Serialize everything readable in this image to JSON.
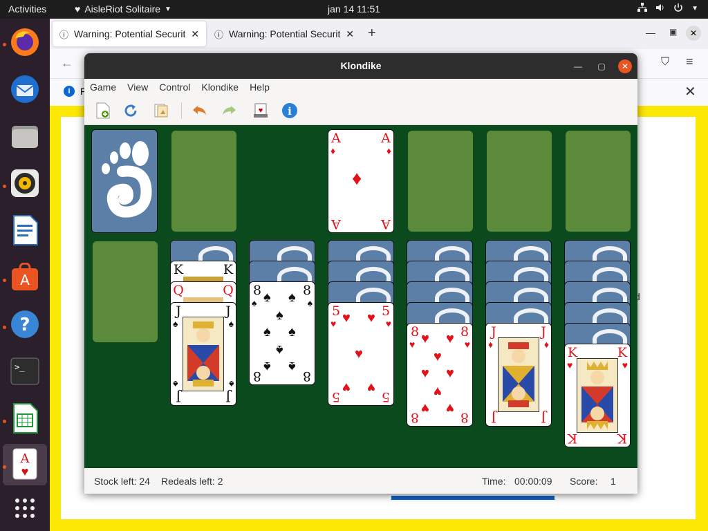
{
  "topbar": {
    "activities": "Activities",
    "app_name": "AisleRiot Solitaire",
    "clock": "jan 14  11:51"
  },
  "browser": {
    "tabs": [
      {
        "label": "Warning: Potential Security Risk Ahead"
      },
      {
        "label": "Warning: Potential Security Risk Ahead"
      }
    ],
    "infobar_fragment": "F",
    "content_fragment": "d"
  },
  "window": {
    "title": "Klondike",
    "menu": [
      "Game",
      "View",
      "Control",
      "Klondike",
      "Help"
    ],
    "toolbar": [
      "new-game",
      "restart",
      "select-game",
      "undo",
      "redo",
      "hint",
      "about"
    ]
  },
  "game": {
    "foundation": [
      {
        "rank": "A",
        "suit": "♦",
        "color": "red"
      }
    ],
    "tableau": [
      {
        "down": 1,
        "up": [
          {
            "rank": "K",
            "suit": "♠"
          },
          {
            "rank": "Q",
            "suit": "♥"
          },
          {
            "rank": "J",
            "suit": "♠"
          }
        ]
      },
      {
        "down": 2,
        "up": [
          {
            "rank": "8",
            "suit": "♠"
          }
        ]
      },
      {
        "down": 3,
        "up": [
          {
            "rank": "5",
            "suit": "♥"
          }
        ]
      },
      {
        "down": 4,
        "up": [
          {
            "rank": "8",
            "suit": "♥"
          }
        ]
      },
      {
        "down": 4,
        "up": [
          {
            "rank": "J",
            "suit": "♦"
          }
        ]
      },
      {
        "down": 5,
        "up": [
          {
            "rank": "K",
            "suit": "♥"
          }
        ]
      }
    ]
  },
  "status": {
    "stock_left": "Stock left: 24",
    "redeals_left": "Redeals left: 2",
    "time_label": "Time:",
    "time_value": "00:00:09",
    "score_label": "Score:",
    "score_value": "1"
  }
}
